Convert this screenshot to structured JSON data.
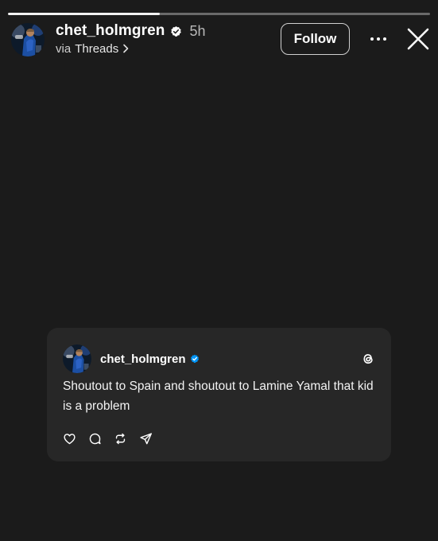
{
  "story": {
    "progress": 0.36
  },
  "header": {
    "username": "chet_holmgren",
    "time": "5h",
    "via_label": "via",
    "via_app": "Threads",
    "follow_label": "Follow"
  },
  "post": {
    "username": "chet_holmgren",
    "text": "Shoutout to Spain and shoutout to Lamine Yamal that kid is a problem"
  },
  "icons": {
    "verified": "verified-badge-icon",
    "chevron": "chevron-right-icon",
    "more": "more-horizontal-icon",
    "close": "close-icon",
    "threads": "threads-logo-icon",
    "like": "heart-icon",
    "reply": "comment-icon",
    "repost": "repost-icon",
    "share": "send-icon"
  },
  "colors": {
    "background": "#1b1b1b",
    "card": "#272727",
    "verified_card": "#0095f6",
    "text": "#ffffff"
  }
}
